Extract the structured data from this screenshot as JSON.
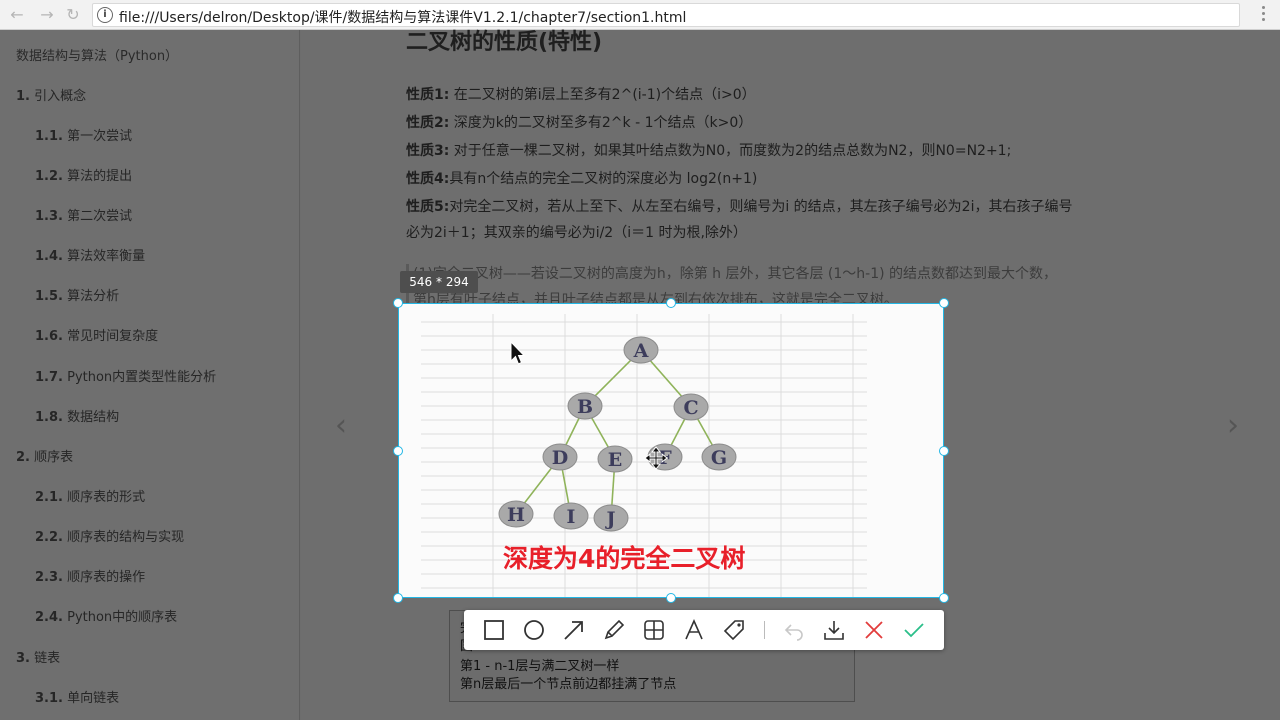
{
  "browser": {
    "url": "file:///Users/delron/Desktop/课件/数据结构与算法课件V1.2.1/chapter7/section1.html",
    "info_icon": "info-icon",
    "back_icon": "back-arrow-icon",
    "forward_icon": "forward-arrow-icon",
    "reload_icon": "reload-icon"
  },
  "sidebar": {
    "title": "数据结构与算法（Python）",
    "items": [
      {
        "num": "1.",
        "label": " 引入概念"
      },
      {
        "num": "1.1.",
        "label": " 第一次尝试"
      },
      {
        "num": "1.2.",
        "label": " 算法的提出"
      },
      {
        "num": "1.3.",
        "label": " 第二次尝试"
      },
      {
        "num": "1.4.",
        "label": " 算法效率衡量"
      },
      {
        "num": "1.5.",
        "label": " 算法分析"
      },
      {
        "num": "1.6.",
        "label": " 常见时间复杂度"
      },
      {
        "num": "1.7.",
        "label": " Python内置类型性能分析"
      },
      {
        "num": "1.8.",
        "label": " 数据结构"
      },
      {
        "num": "2.",
        "label": " 顺序表"
      },
      {
        "num": "2.1.",
        "label": " 顺序表的形式"
      },
      {
        "num": "2.2.",
        "label": " 顺序表的结构与实现"
      },
      {
        "num": "2.3.",
        "label": " 顺序表的操作"
      },
      {
        "num": "2.4.",
        "label": " Python中的顺序表"
      },
      {
        "num": "3.",
        "label": " 链表"
      },
      {
        "num": "3.1.",
        "label": " 单向链表"
      }
    ]
  },
  "main": {
    "title": "二叉树的性质(特性)",
    "props": [
      {
        "label": "性质1:",
        "text": " 在二叉树的第i层上至多有2^(i-1)个结点（i>0）"
      },
      {
        "label": "性质2:",
        "text": " 深度为k的二叉树至多有2^k - 1个结点（k>0）"
      },
      {
        "label": "性质3:",
        "text": " 对于任意一棵二叉树，如果其叶结点数为N0，而度数为2的结点总数为N2，则N0=N2+1;"
      },
      {
        "label": "性质4:",
        "text": "具有n个结点的完全二叉树的深度必为 log2(n+1)"
      },
      {
        "label": "性质5:",
        "text": "对完全二叉树，若从上至下、从左至右编号，则编号为i 的结点，其左孩子编号必为2i，其右孩子编号"
      }
    ],
    "prop5_cont": "必为2i＋1；其双亲的编号必为i/2（i＝1 时为根,除外）",
    "quote_line1": "(1)完全二叉树——若设二叉树的高度为h，除第 h 层外，其它各层 (1～h-1) 的结点数都达到最大个数，",
    "quote_line2": "第h层有叶子结点，并且叶子结点都是从左到右依次排布，这就是完全二叉树。",
    "bottom_note": {
      "line1": "完",
      "line2": "国",
      "line3": "第1 - n-1层与满二叉树一样",
      "line4": "第n层最后一个节点前边都挂满了节点"
    }
  },
  "capture": {
    "size_label": "546 * 294",
    "caption": "深度为4的完全二叉树",
    "nodes": [
      "A",
      "B",
      "C",
      "D",
      "E",
      "F",
      "G",
      "H",
      "I",
      "J"
    ]
  },
  "toolbar": {
    "tools": [
      "rectangle-icon",
      "ellipse-icon",
      "arrow-icon",
      "pen-icon",
      "mosaic-icon",
      "text-icon",
      "tag-icon",
      "undo-icon",
      "download-icon",
      "cancel-icon",
      "confirm-icon"
    ]
  },
  "colors": {
    "selection_border": "#23b7e5",
    "caption_red": "#e8202a",
    "confirm_green": "#2bbf8a",
    "cancel_red": "#e23c3c"
  }
}
